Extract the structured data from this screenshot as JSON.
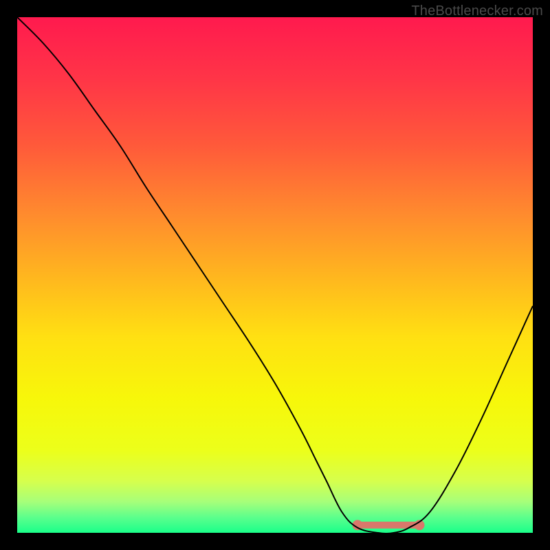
{
  "attribution": "TheBottleneсker.com",
  "chart_data": {
    "type": "line",
    "title": "",
    "xlabel": "",
    "ylabel": "",
    "xlim": [
      0,
      100
    ],
    "ylim": [
      0,
      100
    ],
    "series": [
      {
        "name": "bottleneck-curve",
        "x": [
          0,
          5,
          10,
          15,
          20,
          25,
          30,
          35,
          40,
          45,
          50,
          55,
          58,
          60,
          63,
          66,
          70,
          73,
          76,
          80,
          85,
          90,
          95,
          100
        ],
        "values": [
          100,
          95,
          89,
          82,
          75,
          67,
          59.5,
          52,
          44.5,
          37,
          29,
          20,
          14,
          10,
          4,
          1,
          0,
          0,
          1,
          4,
          12,
          22,
          33,
          44
        ],
        "color": "#000000",
        "stroke_width": 2
      }
    ],
    "flat_segment": {
      "x_start": 66,
      "x_end": 78,
      "y": 1.5,
      "color": "#d9786b",
      "stroke_width": 10,
      "end_dots": true
    },
    "background_gradient": {
      "type": "vertical",
      "stops": [
        {
          "offset": 0.0,
          "color": "#ff1a4e"
        },
        {
          "offset": 0.12,
          "color": "#ff3547"
        },
        {
          "offset": 0.25,
          "color": "#ff5a3a"
        },
        {
          "offset": 0.38,
          "color": "#ff8a2e"
        },
        {
          "offset": 0.5,
          "color": "#ffb51f"
        },
        {
          "offset": 0.62,
          "color": "#ffe012"
        },
        {
          "offset": 0.74,
          "color": "#f7f70a"
        },
        {
          "offset": 0.84,
          "color": "#ecff1a"
        },
        {
          "offset": 0.9,
          "color": "#d6ff4d"
        },
        {
          "offset": 0.94,
          "color": "#a6ff7a"
        },
        {
          "offset": 0.97,
          "color": "#5cff8c"
        },
        {
          "offset": 1.0,
          "color": "#1aff8a"
        }
      ]
    }
  }
}
